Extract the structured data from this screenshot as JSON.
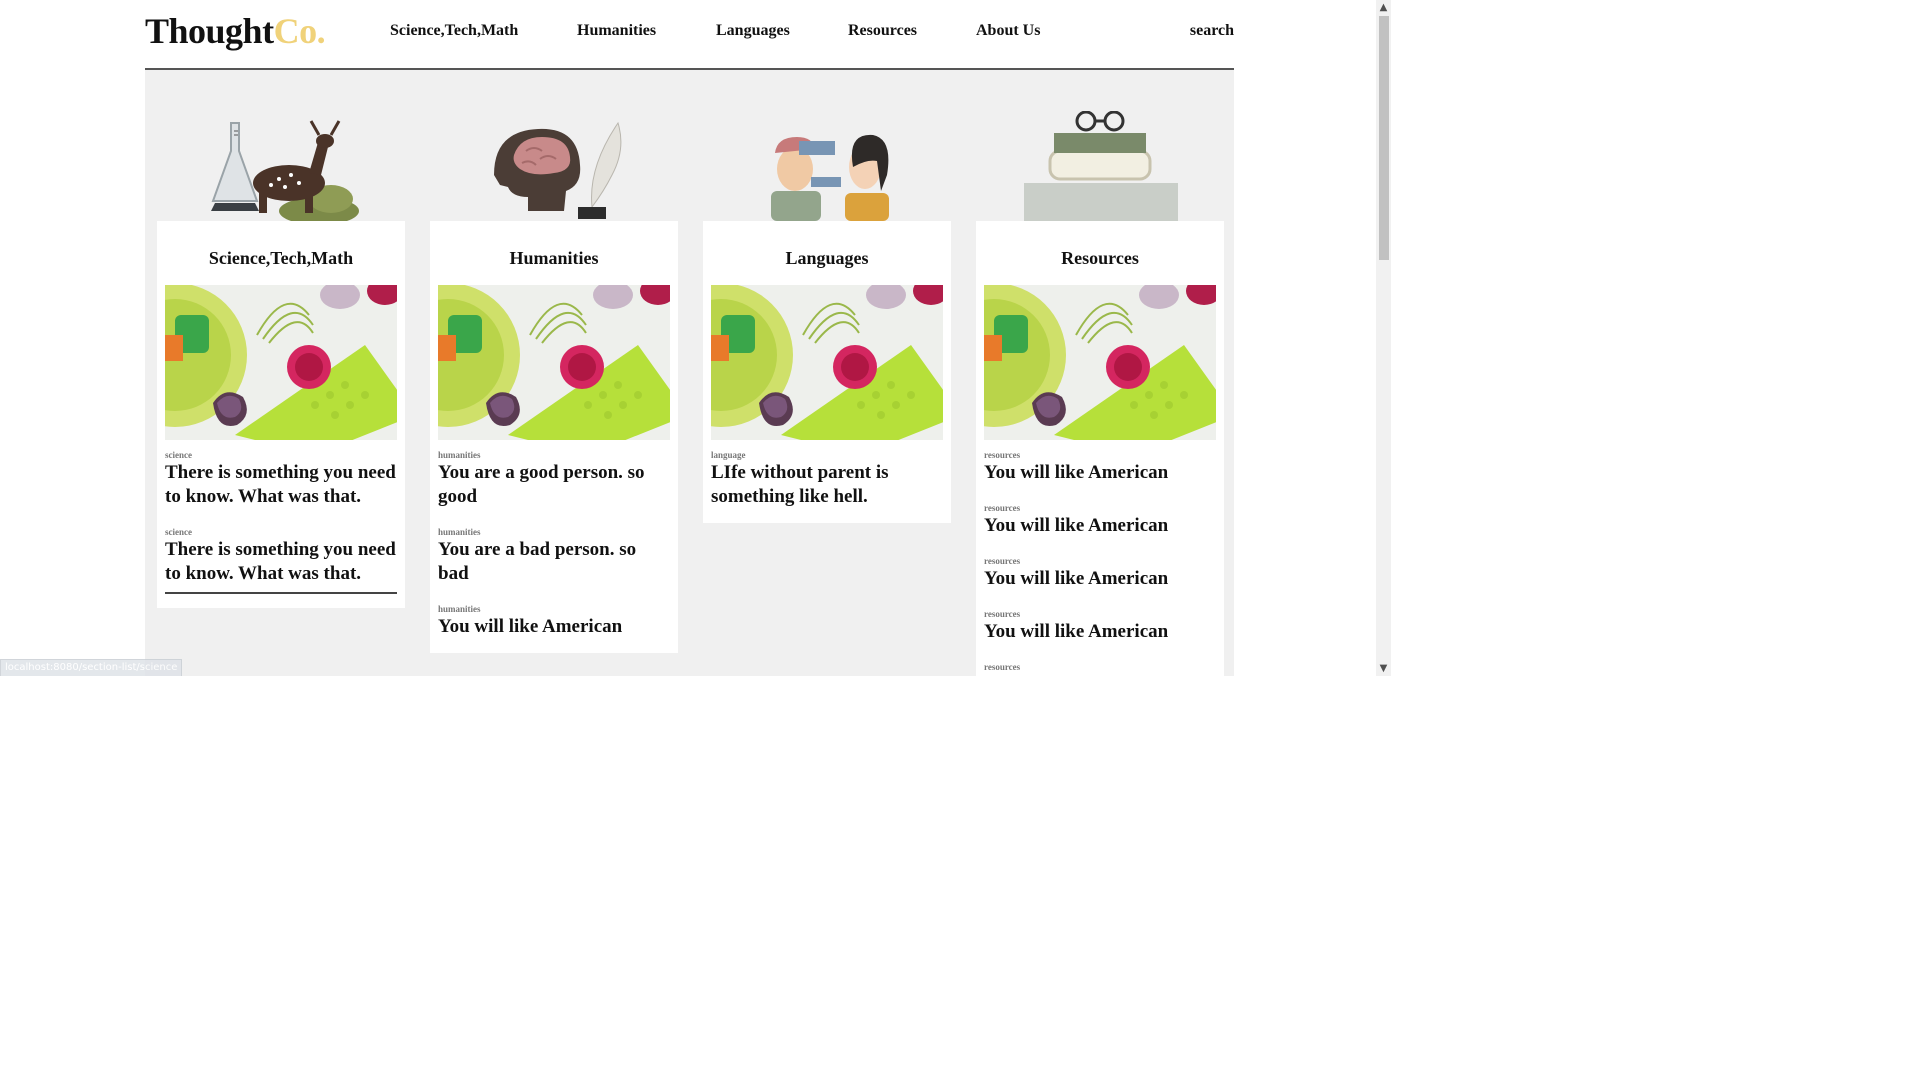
{
  "header": {
    "logo_main": "Thought",
    "logo_accent": "Co.",
    "nav": [
      "Science,Tech,Math",
      "Humanities",
      "Languages",
      "Resources",
      "About Us"
    ],
    "search_label": "search"
  },
  "columns": [
    {
      "title": "Science,Tech,Math",
      "illustration": "deer-flask-icon",
      "articles": [
        {
          "category": "science",
          "headline": "There is something you need to know. What was that."
        },
        {
          "category": "science",
          "headline": "There is something you need to know. What was that."
        }
      ]
    },
    {
      "title": "Humanities",
      "illustration": "head-brain-quill-icon",
      "articles": [
        {
          "category": "humanities",
          "headline": "You are a good person. so good"
        },
        {
          "category": "humanities",
          "headline": "You are a bad person. so bad"
        },
        {
          "category": "humanities",
          "headline": "You will like American"
        }
      ]
    },
    {
      "title": "Languages",
      "illustration": "two-people-talking-icon",
      "articles": [
        {
          "category": "language",
          "headline": "LIfe without parent is something like hell."
        }
      ]
    },
    {
      "title": "Resources",
      "illustration": "books-glasses-icon",
      "articles": [
        {
          "category": "resources",
          "headline": "You will like American"
        },
        {
          "category": "resources",
          "headline": "You will like American"
        },
        {
          "category": "resources",
          "headline": "You will like American"
        },
        {
          "category": "resources",
          "headline": "You will like American"
        },
        {
          "category": "resources",
          "headline": ""
        }
      ]
    }
  ],
  "status_url": "localhost:8080/section-list/science",
  "colors": {
    "accent": "#f0d27a",
    "content_bg": "#f0f0f0",
    "header_rule": "#555555"
  }
}
